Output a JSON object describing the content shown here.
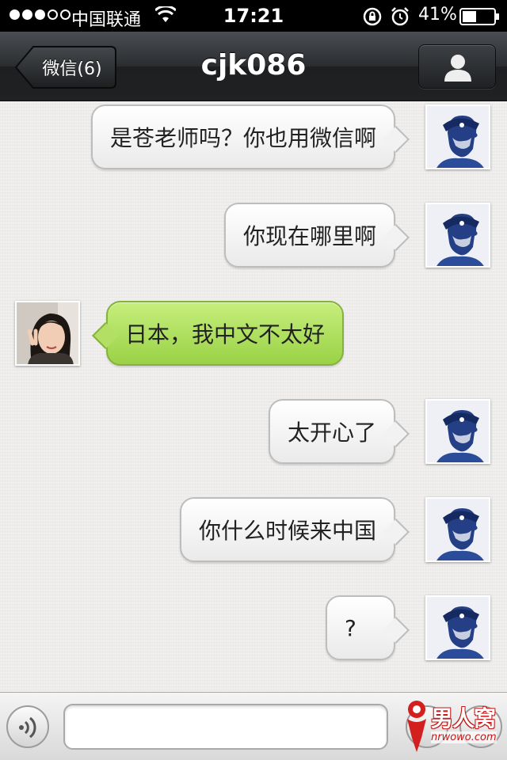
{
  "status_bar": {
    "carrier": "中国联通",
    "time": "17:21",
    "battery": "41%",
    "signal_bars_filled": 3,
    "signal_bars_total": 5
  },
  "nav": {
    "back_label": "微信(6)",
    "title": "cjk086"
  },
  "messages": [
    {
      "direction": "out",
      "text": "是苍老师吗？你也用微信啊"
    },
    {
      "direction": "out",
      "text": "你现在哪里啊"
    },
    {
      "direction": "in",
      "text": "日本，我中文不太好"
    },
    {
      "direction": "out",
      "text": "太开心了"
    },
    {
      "direction": "out",
      "text": "你什么时候来中国"
    },
    {
      "direction": "out",
      "text": "?"
    }
  ],
  "input": {
    "placeholder": "",
    "value": ""
  },
  "watermark": {
    "text": "男人窝",
    "sub": "nrwowo.com"
  },
  "colors": {
    "nav_bg": "#2b2e31",
    "bubble_out": "#f4f4f4",
    "bubble_in": "#a6dc52",
    "chat_bg": "#edecea"
  }
}
